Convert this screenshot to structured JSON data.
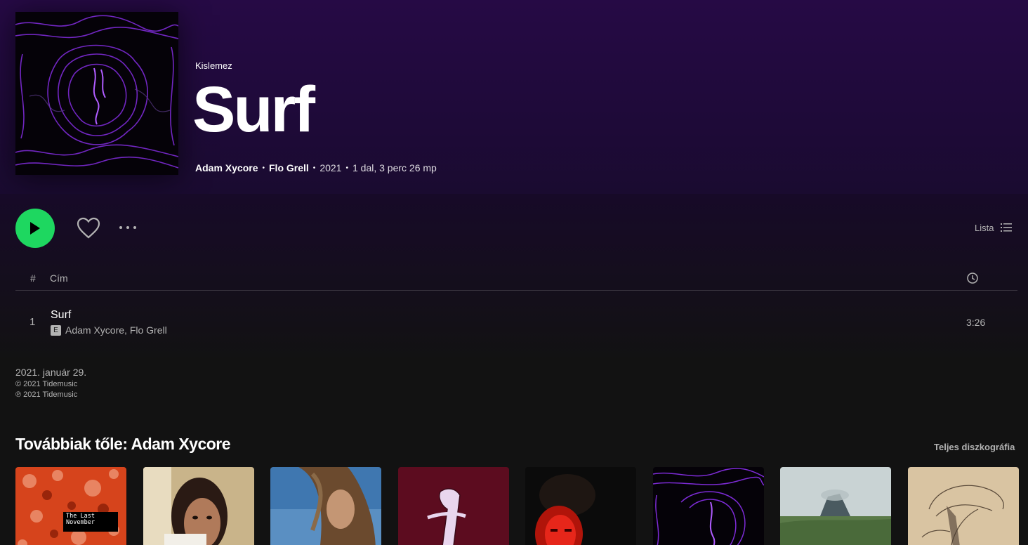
{
  "release": {
    "type_label": "Kislemez",
    "title": "Surf",
    "artists": [
      "Adam Xycore",
      "Flo Grell"
    ],
    "year": "2021",
    "summary": "1 dal, 3 perc 26 mp"
  },
  "actions": {
    "view_label": "Lista"
  },
  "table": {
    "col_num": "#",
    "col_title": "Cím"
  },
  "tracks": [
    {
      "number": "1",
      "title": "Surf",
      "explicit_badge": "E",
      "artists": "Adam Xycore, Flo Grell",
      "duration": "3:26"
    }
  ],
  "footer": {
    "release_date": "2021. január 29.",
    "copyright": "© 2021 Tidemusic",
    "phonogram": "℗ 2021 Tidemusic"
  },
  "more_by": {
    "title": "Továbbiak tőle: Adam Xycore",
    "link_label": "Teljes diszkográfia",
    "albums": [
      {
        "cover_text": "The Last November"
      }
    ]
  },
  "colors": {
    "accent": "#1ed760",
    "hero_bg": "#260a45",
    "page_bg": "#121212",
    "muted_text": "#b3b3b3"
  }
}
